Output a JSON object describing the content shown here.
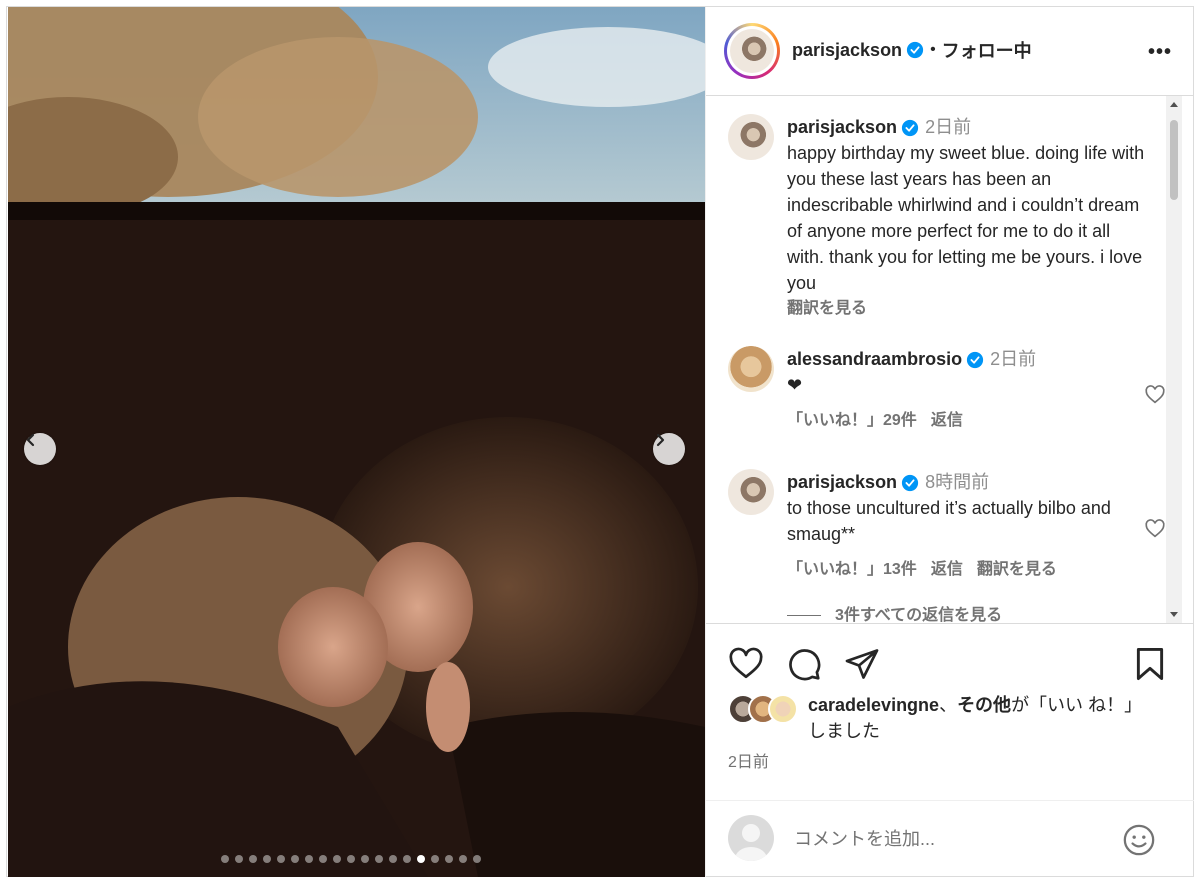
{
  "post": {
    "header": {
      "username": "parisjackson",
      "separator": "•",
      "follow_status": "フォロー中",
      "more_label": "•••"
    },
    "caption": {
      "username": "parisjackson",
      "time": "2日前",
      "text": "happy birthday my sweet blue. doing life with you these last years has been an indescribable whirlwind and i couldn’t dream of anyone more perfect for me to do it all with. thank you for letting me be yours. i love you",
      "translate": "翻訳を見る"
    },
    "comments": [
      {
        "username": "alessandraambrosio",
        "time": "2日前",
        "text": "❤",
        "likes": "「いいね！」29件",
        "reply": "返信"
      },
      {
        "username": "parisjackson",
        "time": "8時間前",
        "text": "to those uncultured it’s actually bilbo and smaug**",
        "likes": "「いいね！」13件",
        "reply": "返信",
        "translate": "翻訳を見る",
        "view_replies": "3件すべての返信を見る"
      }
    ],
    "liked_by": {
      "user": "caradelevingne",
      "connector": "、",
      "others": "その他",
      "suffix_1": "が「いい",
      "suffix_2": "ね！」しました"
    },
    "date": "2日前",
    "comment_input": {
      "placeholder": "コメントを追加..."
    },
    "carousel": {
      "total": 19,
      "active": 14
    },
    "icons": {
      "prev": "chevron-left-icon",
      "next": "chevron-right-icon",
      "like": "heart-icon",
      "comment": "comment-icon",
      "share": "paper-plane-icon",
      "save": "bookmark-icon",
      "emoji": "smiley-icon",
      "verified": "verified-badge-icon"
    },
    "colors": {
      "verified": "#0095f6",
      "text": "#262626",
      "muted": "#737373"
    }
  }
}
